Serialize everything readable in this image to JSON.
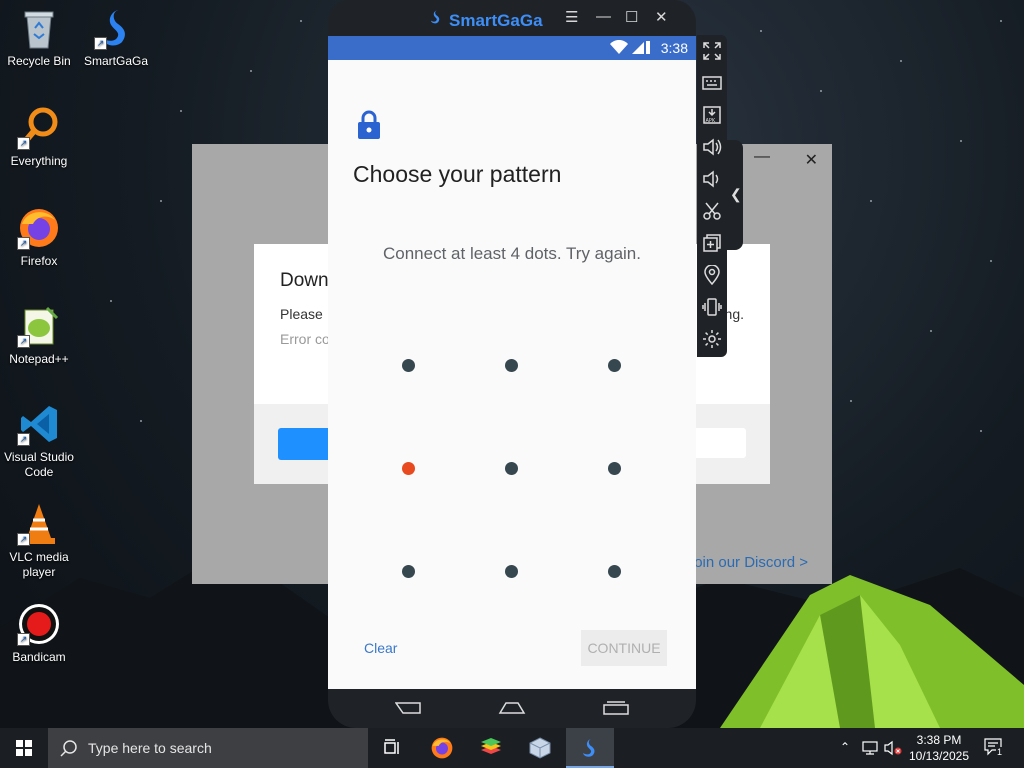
{
  "desktop": {
    "icons": [
      {
        "label": "Recycle Bin",
        "icon": "recycle-bin-icon"
      },
      {
        "label": "SmartGaGa",
        "icon": "smartgaga-swan-icon"
      },
      {
        "label": "Everything",
        "icon": "everything-magnifier-icon"
      },
      {
        "label": "Firefox",
        "icon": "firefox-icon"
      },
      {
        "label": "Notepad++",
        "icon": "notepadpp-icon"
      },
      {
        "label": "Visual Studio Code",
        "icon": "vscode-icon"
      },
      {
        "label": "VLC media player",
        "icon": "vlc-cone-icon"
      },
      {
        "label": "Bandicam",
        "icon": "bandicam-record-icon"
      }
    ]
  },
  "background_dialog": {
    "title_partial": "Down",
    "line1_partial": "Please",
    "line1_end": "ng.",
    "line2_partial": "Error co",
    "discord_link": "Join our Discord >"
  },
  "emulator": {
    "app_name": "SmartGaGa",
    "status_time": "3:38",
    "screen": {
      "title": "Choose your pattern",
      "message": "Connect at least 4 dots. Try again.",
      "clear_label": "Clear",
      "continue_label": "CONTINUE",
      "pattern": {
        "rows": 3,
        "cols": 3,
        "selected_dot": [
          1,
          0
        ]
      }
    },
    "toolbar": [
      "fullscreen-icon",
      "keyboard-icon",
      "apk-install-icon",
      "volume-up-icon",
      "volume-down-icon",
      "scissors-icon",
      "multi-instance-icon",
      "location-icon",
      "shake-icon",
      "settings-gear-icon"
    ]
  },
  "taskbar": {
    "search_placeholder": "Type here to search",
    "clock_time": "3:38 PM",
    "clock_date": "10/13/2025",
    "notification_count": "1"
  },
  "colors": {
    "accent_blue": "#3a6cc9",
    "error_dot": "#e8491e",
    "dot": "#37474f",
    "link_blue": "#3a78c9"
  }
}
